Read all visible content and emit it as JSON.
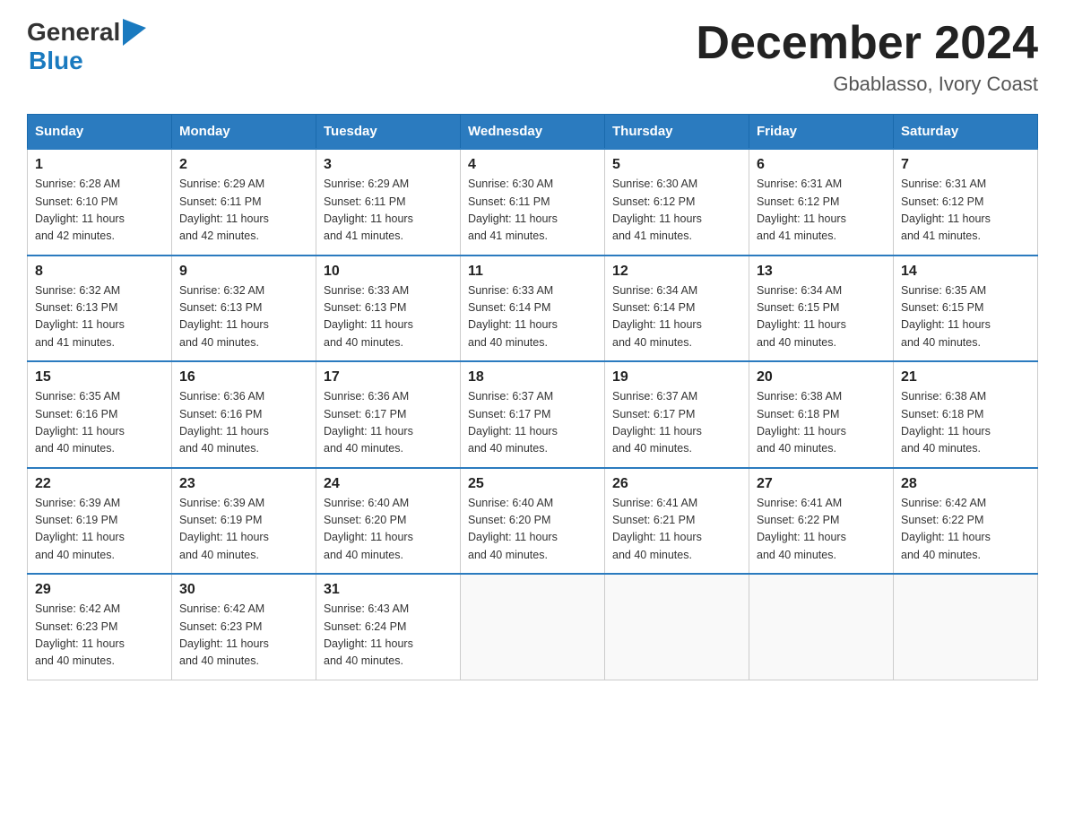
{
  "logo": {
    "general": "General",
    "blue": "Blue"
  },
  "title": "December 2024",
  "location": "Gbablasso, Ivory Coast",
  "headers": [
    "Sunday",
    "Monday",
    "Tuesday",
    "Wednesday",
    "Thursday",
    "Friday",
    "Saturday"
  ],
  "weeks": [
    [
      {
        "day": "1",
        "sunrise": "6:28 AM",
        "sunset": "6:10 PM",
        "daylight": "11 hours and 42 minutes."
      },
      {
        "day": "2",
        "sunrise": "6:29 AM",
        "sunset": "6:11 PM",
        "daylight": "11 hours and 42 minutes."
      },
      {
        "day": "3",
        "sunrise": "6:29 AM",
        "sunset": "6:11 PM",
        "daylight": "11 hours and 41 minutes."
      },
      {
        "day": "4",
        "sunrise": "6:30 AM",
        "sunset": "6:11 PM",
        "daylight": "11 hours and 41 minutes."
      },
      {
        "day": "5",
        "sunrise": "6:30 AM",
        "sunset": "6:12 PM",
        "daylight": "11 hours and 41 minutes."
      },
      {
        "day": "6",
        "sunrise": "6:31 AM",
        "sunset": "6:12 PM",
        "daylight": "11 hours and 41 minutes."
      },
      {
        "day": "7",
        "sunrise": "6:31 AM",
        "sunset": "6:12 PM",
        "daylight": "11 hours and 41 minutes."
      }
    ],
    [
      {
        "day": "8",
        "sunrise": "6:32 AM",
        "sunset": "6:13 PM",
        "daylight": "11 hours and 41 minutes."
      },
      {
        "day": "9",
        "sunrise": "6:32 AM",
        "sunset": "6:13 PM",
        "daylight": "11 hours and 40 minutes."
      },
      {
        "day": "10",
        "sunrise": "6:33 AM",
        "sunset": "6:13 PM",
        "daylight": "11 hours and 40 minutes."
      },
      {
        "day": "11",
        "sunrise": "6:33 AM",
        "sunset": "6:14 PM",
        "daylight": "11 hours and 40 minutes."
      },
      {
        "day": "12",
        "sunrise": "6:34 AM",
        "sunset": "6:14 PM",
        "daylight": "11 hours and 40 minutes."
      },
      {
        "day": "13",
        "sunrise": "6:34 AM",
        "sunset": "6:15 PM",
        "daylight": "11 hours and 40 minutes."
      },
      {
        "day": "14",
        "sunrise": "6:35 AM",
        "sunset": "6:15 PM",
        "daylight": "11 hours and 40 minutes."
      }
    ],
    [
      {
        "day": "15",
        "sunrise": "6:35 AM",
        "sunset": "6:16 PM",
        "daylight": "11 hours and 40 minutes."
      },
      {
        "day": "16",
        "sunrise": "6:36 AM",
        "sunset": "6:16 PM",
        "daylight": "11 hours and 40 minutes."
      },
      {
        "day": "17",
        "sunrise": "6:36 AM",
        "sunset": "6:17 PM",
        "daylight": "11 hours and 40 minutes."
      },
      {
        "day": "18",
        "sunrise": "6:37 AM",
        "sunset": "6:17 PM",
        "daylight": "11 hours and 40 minutes."
      },
      {
        "day": "19",
        "sunrise": "6:37 AM",
        "sunset": "6:17 PM",
        "daylight": "11 hours and 40 minutes."
      },
      {
        "day": "20",
        "sunrise": "6:38 AM",
        "sunset": "6:18 PM",
        "daylight": "11 hours and 40 minutes."
      },
      {
        "day": "21",
        "sunrise": "6:38 AM",
        "sunset": "6:18 PM",
        "daylight": "11 hours and 40 minutes."
      }
    ],
    [
      {
        "day": "22",
        "sunrise": "6:39 AM",
        "sunset": "6:19 PM",
        "daylight": "11 hours and 40 minutes."
      },
      {
        "day": "23",
        "sunrise": "6:39 AM",
        "sunset": "6:19 PM",
        "daylight": "11 hours and 40 minutes."
      },
      {
        "day": "24",
        "sunrise": "6:40 AM",
        "sunset": "6:20 PM",
        "daylight": "11 hours and 40 minutes."
      },
      {
        "day": "25",
        "sunrise": "6:40 AM",
        "sunset": "6:20 PM",
        "daylight": "11 hours and 40 minutes."
      },
      {
        "day": "26",
        "sunrise": "6:41 AM",
        "sunset": "6:21 PM",
        "daylight": "11 hours and 40 minutes."
      },
      {
        "day": "27",
        "sunrise": "6:41 AM",
        "sunset": "6:22 PM",
        "daylight": "11 hours and 40 minutes."
      },
      {
        "day": "28",
        "sunrise": "6:42 AM",
        "sunset": "6:22 PM",
        "daylight": "11 hours and 40 minutes."
      }
    ],
    [
      {
        "day": "29",
        "sunrise": "6:42 AM",
        "sunset": "6:23 PM",
        "daylight": "11 hours and 40 minutes."
      },
      {
        "day": "30",
        "sunrise": "6:42 AM",
        "sunset": "6:23 PM",
        "daylight": "11 hours and 40 minutes."
      },
      {
        "day": "31",
        "sunrise": "6:43 AM",
        "sunset": "6:24 PM",
        "daylight": "11 hours and 40 minutes."
      },
      null,
      null,
      null,
      null
    ]
  ],
  "sunriseLabel": "Sunrise:",
  "sunsetLabel": "Sunset:",
  "daylightLabel": "Daylight:"
}
